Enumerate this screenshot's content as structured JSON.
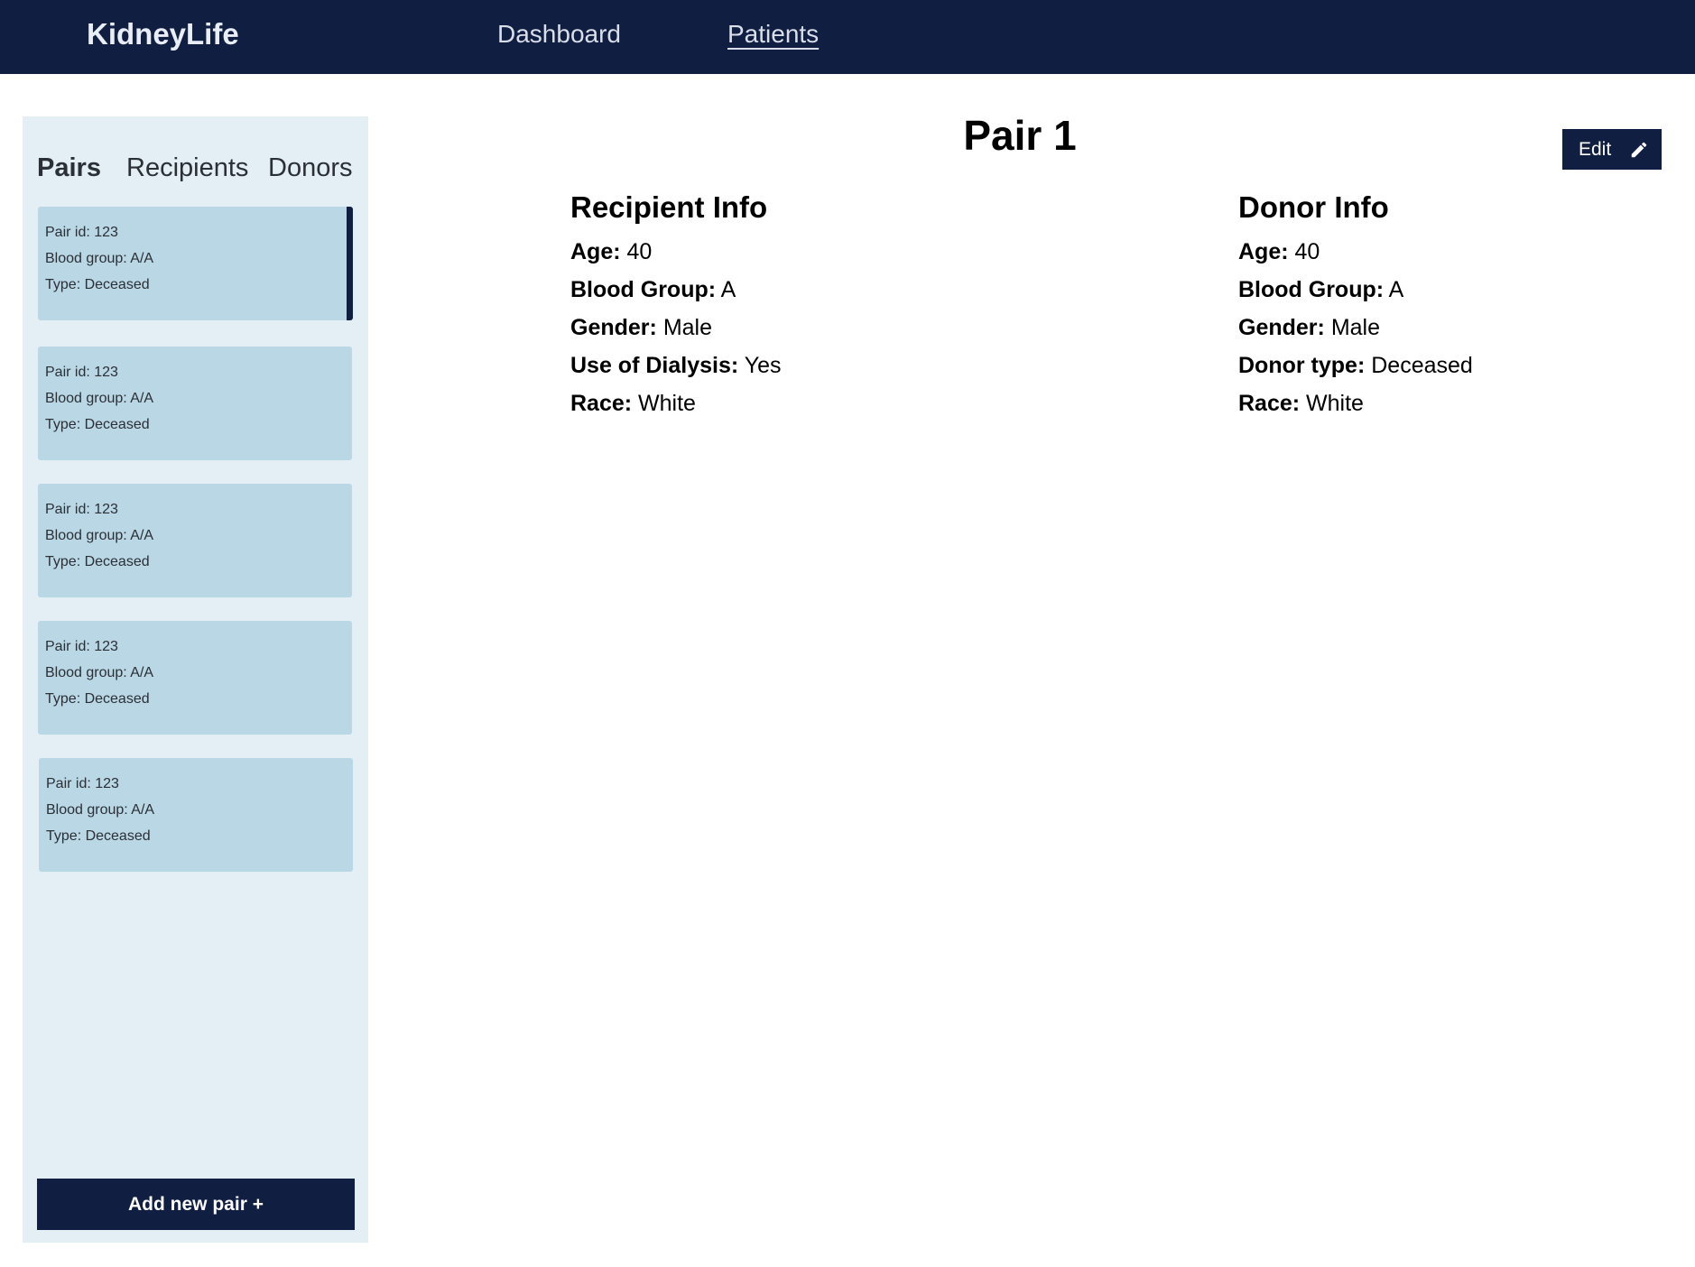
{
  "app": {
    "brand": "KidneyLife",
    "nav": {
      "dashboard": "Dashboard",
      "patients": "Patients"
    }
  },
  "sidebar": {
    "tabs": {
      "pairs": "Pairs",
      "recipients": "Recipients",
      "donors": "Donors"
    },
    "cards": [
      {
        "pair_id": "Pair id: 123",
        "blood_group": "Blood group: A/A",
        "type": "Type: Deceased",
        "selected": true
      },
      {
        "pair_id": "Pair id: 123",
        "blood_group": "Blood group: A/A",
        "type": "Type: Deceased",
        "selected": false
      },
      {
        "pair_id": "Pair id: 123",
        "blood_group": "Blood group: A/A",
        "type": "Type: Deceased",
        "selected": false
      },
      {
        "pair_id": "Pair id: 123",
        "blood_group": "Blood group: A/A",
        "type": "Type: Deceased",
        "selected": false
      },
      {
        "pair_id": "Pair id: 123",
        "blood_group": "Blood group: A/A",
        "type": "Type: Deceased",
        "selected": false
      }
    ],
    "add_button": "Add new pair +"
  },
  "main": {
    "title": "Pair 1",
    "edit_button": "Edit",
    "edit_icon": "pencil-icon",
    "recipient": {
      "heading": "Recipient Info",
      "rows": [
        {
          "label": "Age:",
          "value": "40"
        },
        {
          "label": "Blood Group:",
          "value": "A"
        },
        {
          "label": "Gender:",
          "value": "Male"
        },
        {
          "label": "Use of Dialysis:",
          "value": "Yes"
        },
        {
          "label": "Race:",
          "value": "White"
        }
      ]
    },
    "donor": {
      "heading": "Donor Info",
      "rows": [
        {
          "label": "Age:",
          "value": "40"
        },
        {
          "label": "Blood Group:",
          "value": "A"
        },
        {
          "label": "Gender:",
          "value": "Male"
        },
        {
          "label": "Donor type:",
          "value": "Deceased"
        },
        {
          "label": "Race:",
          "value": "White"
        }
      ]
    }
  },
  "colors": {
    "navy": "#101e41",
    "sidebar_bg": "#e3eff5",
    "card_bg": "#b9d7e4"
  }
}
